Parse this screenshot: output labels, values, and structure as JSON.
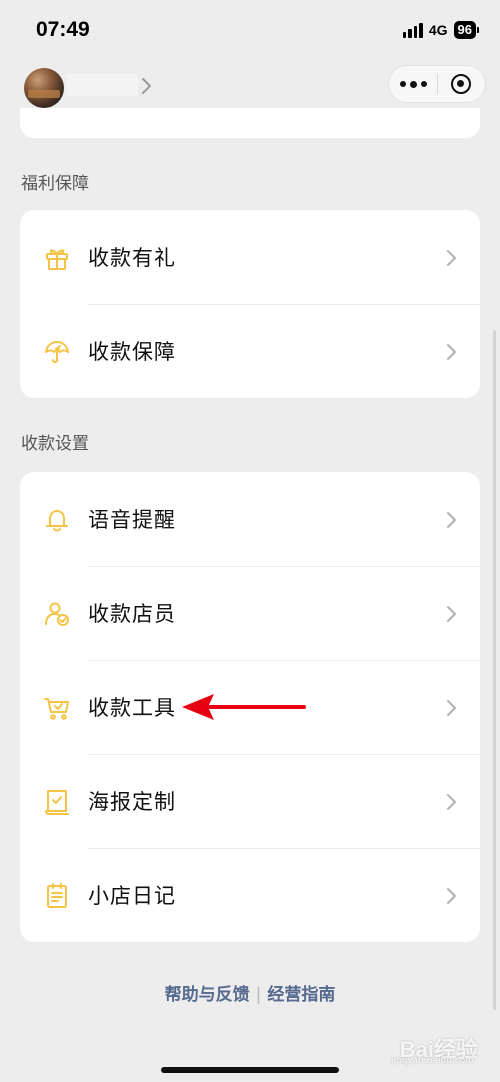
{
  "status_bar": {
    "time": "07:49",
    "network": "4G",
    "battery": "96"
  },
  "nav": {
    "avatar_icon": "user-avatar",
    "more_icon": "more-dots-icon",
    "close_icon": "mini-program-close-icon"
  },
  "sections": {
    "welfare": {
      "title": "福利保障",
      "items": [
        {
          "label": "收款有礼",
          "icon": "gift-icon"
        },
        {
          "label": "收款保障",
          "icon": "umbrella-shield-icon"
        }
      ]
    },
    "settings": {
      "title": "收款设置",
      "items": [
        {
          "label": "语音提醒",
          "icon": "bell-icon"
        },
        {
          "label": "收款店员",
          "icon": "staff-check-icon"
        },
        {
          "label": "收款工具",
          "icon": "cart-check-icon"
        },
        {
          "label": "海报定制",
          "icon": "poster-check-icon"
        },
        {
          "label": "小店日记",
          "icon": "notebook-icon"
        }
      ]
    }
  },
  "footer": {
    "help_link": "帮助与反馈",
    "divider": "|",
    "guide_link": "经营指南"
  },
  "watermark": {
    "main": "Bai经验",
    "sub": "jingyan.baidu.com"
  },
  "colors": {
    "accent": "#f5c447",
    "background": "#ededed",
    "link": "#56698f",
    "arrow": "#e60012"
  }
}
